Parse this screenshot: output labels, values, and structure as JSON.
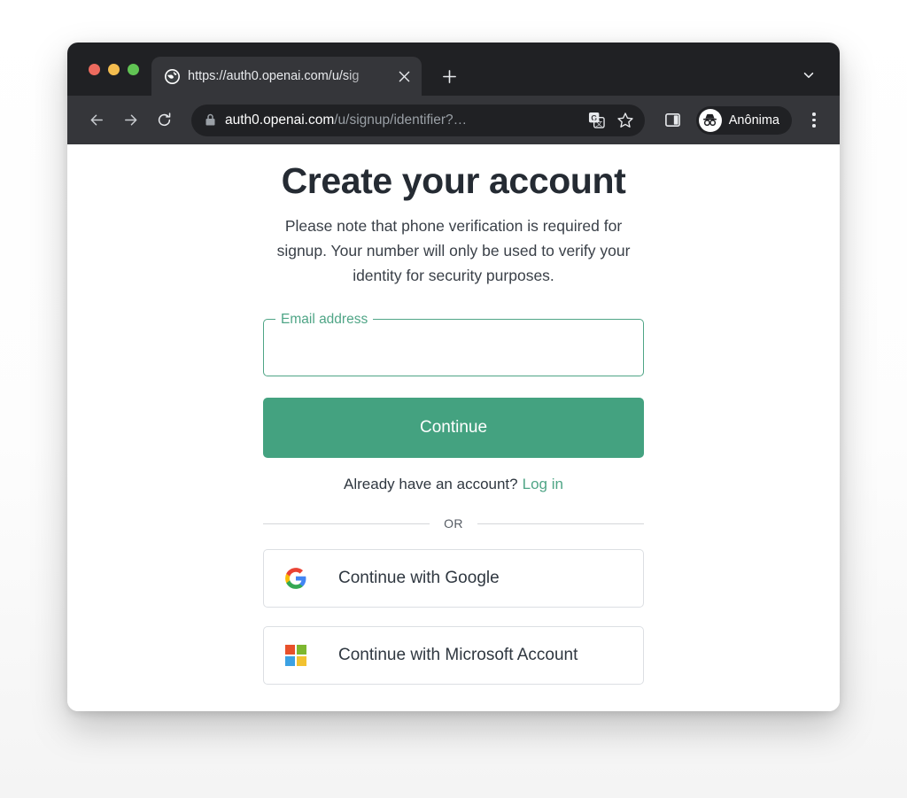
{
  "browser": {
    "traffic_lights": [
      "close",
      "minimize",
      "maximize"
    ],
    "tab": {
      "title": "https://auth0.openai.com/u/sig",
      "favicon": "globe-icon",
      "close_label": "✕"
    },
    "new_tab_label": "+",
    "tab_search_icon": "chevron-down-icon",
    "nav": {
      "back_label": "←",
      "forward_label": "→",
      "reload_label": "↻"
    },
    "omnibox": {
      "lock_icon": "lock-icon",
      "url_host": "auth0.openai.com",
      "url_path": "/u/signup/identifier?…",
      "translate_icon": "translate-icon",
      "bookmark_icon": "star-icon"
    },
    "side_panel_icon": "side-panel-icon",
    "profile": {
      "avatar_icon": "incognito-icon",
      "name": "Anônima"
    },
    "menu_icon": "three-dot-menu-icon"
  },
  "page": {
    "title": "Create your account",
    "subtitle": "Please note that phone verification is required for signup. Your number will only be used to verify your identity for security purposes.",
    "email_field": {
      "label": "Email address",
      "value": "",
      "placeholder": ""
    },
    "continue_button": "Continue",
    "login_prompt": "Already have an account?",
    "login_link": "Log in",
    "divider_text": "OR",
    "social_buttons": [
      {
        "label": "Continue with Google",
        "icon": "google-logo-icon"
      },
      {
        "label": "Continue with Microsoft Account",
        "icon": "microsoft-logo-icon"
      }
    ]
  },
  "colors": {
    "accent_green": "#44a280",
    "field_green": "#4fa586",
    "toolbar_dark": "#35363a",
    "tabstrip_dark": "#202124",
    "text_dark": "#252b33"
  }
}
